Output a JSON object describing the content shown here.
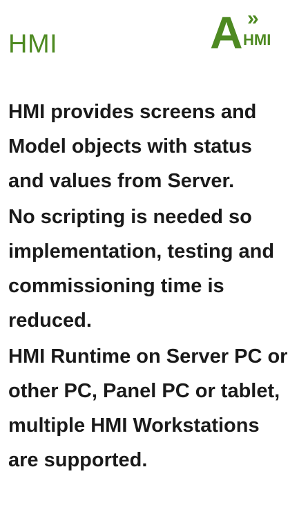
{
  "header": {
    "title": "HMI",
    "logo": {
      "letter": "A",
      "chevrons": "»",
      "text": "HMI",
      "color": "#4e8a22"
    }
  },
  "paragraphs": [
    [
      "HMI provides screens and",
      "Model objects with  status",
      "and values from Server."
    ],
    [
      "No scripting is needed so",
      "implementation, testing and",
      "commissioning time is",
      "reduced."
    ],
    [
      "HMI Runtime on Server PC or",
      "other PC, Panel PC or tablet,",
      "multiple HMI Workstations",
      "are supported."
    ]
  ],
  "colors": {
    "accent": "#4e8a22",
    "text": "#1a1a1a",
    "background": "#ffffff"
  }
}
